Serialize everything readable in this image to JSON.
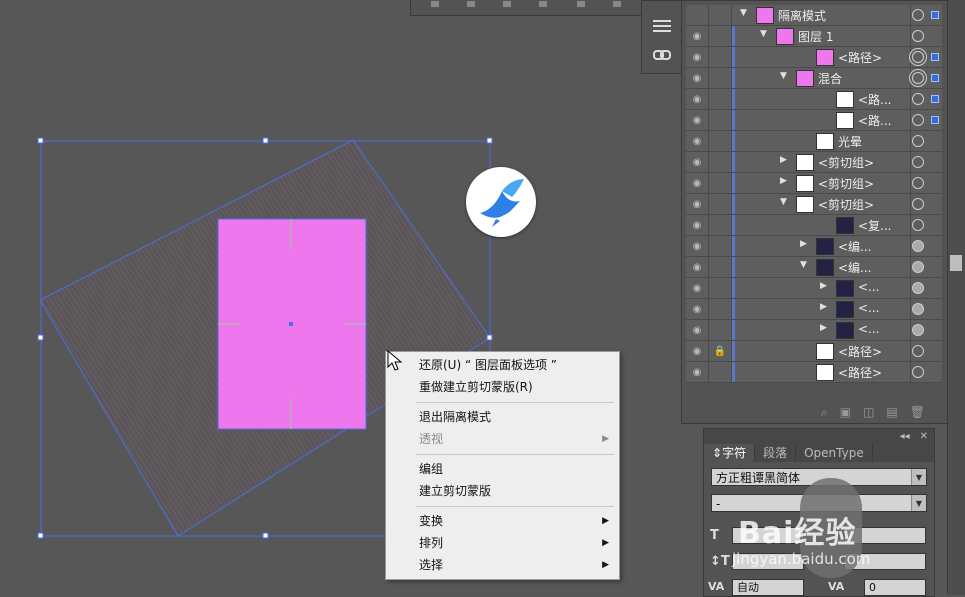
{
  "colors": {
    "canvas_bg": "#575757",
    "selection": "#4a6fe3",
    "artboard_fill": "#ee77ee",
    "menu_bg": "#eeeeee",
    "layer_blue": "#5a76c8"
  },
  "layers_panel": {
    "rows": [
      {
        "name": "隔离模式",
        "indent": 0,
        "expanded": true,
        "thumb": "pink",
        "has_eye": false
      },
      {
        "name": "图层 1",
        "indent": 1,
        "expanded": true,
        "thumb": "pink",
        "has_eye": true
      },
      {
        "name": "<路径>",
        "indent": 3,
        "expanded": null,
        "thumb": "pink-rect",
        "has_eye": true
      },
      {
        "name": "混合",
        "indent": 2,
        "expanded": true,
        "thumb": "pink",
        "has_eye": true
      },
      {
        "name": "<路...",
        "indent": 4,
        "expanded": null,
        "thumb": "white",
        "has_eye": true
      },
      {
        "name": "<路...",
        "indent": 4,
        "expanded": null,
        "thumb": "white",
        "has_eye": true
      },
      {
        "name": "光晕",
        "indent": 3,
        "expanded": null,
        "thumb": "white-dot",
        "has_eye": true
      },
      {
        "name": "<剪切组>",
        "indent": 2,
        "expanded": false,
        "thumb": "white-dot",
        "has_eye": true
      },
      {
        "name": "<剪切组>",
        "indent": 2,
        "expanded": false,
        "thumb": "white-dot",
        "has_eye": true
      },
      {
        "name": "<剪切组>",
        "indent": 2,
        "expanded": true,
        "thumb": "white-dot",
        "has_eye": true
      },
      {
        "name": "<复...",
        "indent": 4,
        "expanded": null,
        "thumb": "dark",
        "has_eye": true
      },
      {
        "name": "<编...",
        "indent": 3,
        "expanded": false,
        "thumb": "dark",
        "has_eye": true
      },
      {
        "name": "<编...",
        "indent": 3,
        "expanded": true,
        "thumb": "dark",
        "has_eye": true
      },
      {
        "name": "<...",
        "indent": 4,
        "expanded": false,
        "thumb": "dark",
        "has_eye": true
      },
      {
        "name": "<...",
        "indent": 4,
        "expanded": false,
        "thumb": "dark",
        "has_eye": true
      },
      {
        "name": "<...",
        "indent": 4,
        "expanded": false,
        "thumb": "dark",
        "has_eye": true
      },
      {
        "name": "<路径>",
        "indent": 3,
        "expanded": null,
        "thumb": "white",
        "has_eye": true,
        "locked": true
      },
      {
        "name": "<路径>",
        "indent": 3,
        "expanded": null,
        "thumb": "white-wave",
        "has_eye": true
      }
    ]
  },
  "character_panel": {
    "tabs": [
      "字符",
      "段落",
      "OpenType"
    ],
    "active_tab": "字符",
    "font_family": "方正粗谭黑简体",
    "font_style": "-",
    "tracking_value": "0",
    "kerning_value": "自动"
  },
  "context_menu": {
    "items": [
      {
        "label": "还原(U) “ 图层面板选项 ”",
        "disabled": false,
        "submenu": false
      },
      {
        "label": "重做建立剪切蒙版(R)",
        "disabled": false,
        "submenu": false
      },
      {
        "sep": true
      },
      {
        "label": "退出隔离模式",
        "disabled": false,
        "submenu": false
      },
      {
        "label": "透视",
        "disabled": true,
        "submenu": true
      },
      {
        "sep": true
      },
      {
        "label": "编组",
        "disabled": false,
        "submenu": false
      },
      {
        "label": "建立剪切蒙版",
        "disabled": false,
        "submenu": false
      },
      {
        "sep": true
      },
      {
        "label": "变换",
        "disabled": false,
        "submenu": true
      },
      {
        "label": "排列",
        "disabled": false,
        "submenu": true
      },
      {
        "label": "选择",
        "disabled": false,
        "submenu": true
      }
    ]
  },
  "watermark": {
    "text": "Bai经验",
    "url": "jingyan.baidu.com"
  },
  "icons": {
    "hamburger": "hamburger-icon",
    "link": "link-icon",
    "eye": "eye-icon",
    "lock": "lock-icon",
    "search": "search-icon",
    "trash": "trash-icon",
    "app": "bird-logo-icon"
  }
}
